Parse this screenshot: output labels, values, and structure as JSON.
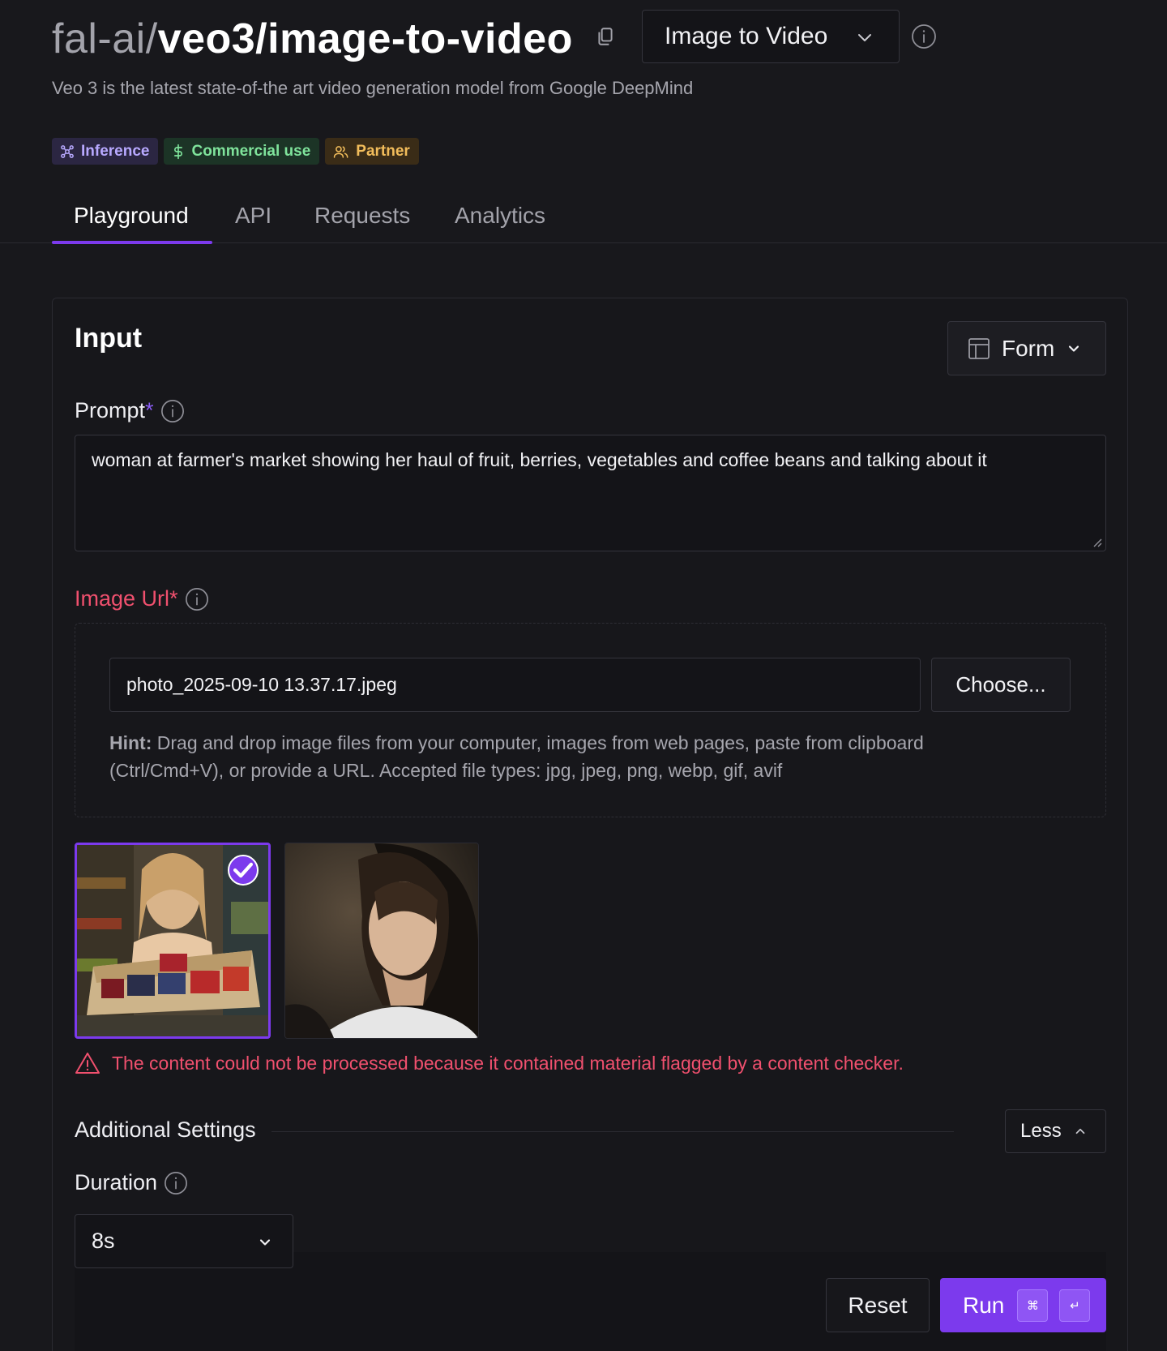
{
  "header": {
    "namespace": "fal-ai/",
    "model_slug": "veo3/image-to-video",
    "mode_select": "Image to Video",
    "subtitle": "Veo 3 is the latest state-of-the art video generation model from Google DeepMind"
  },
  "badges": [
    {
      "label": "Inference",
      "icon": "network-icon"
    },
    {
      "label": "Commercial use",
      "icon": "dollar-icon"
    },
    {
      "label": "Partner",
      "icon": "users-icon"
    }
  ],
  "tabs": [
    {
      "label": "Playground",
      "active": true
    },
    {
      "label": "API",
      "active": false
    },
    {
      "label": "Requests",
      "active": false
    },
    {
      "label": "Analytics",
      "active": false
    }
  ],
  "input": {
    "title": "Input",
    "view_mode": "Form",
    "prompt": {
      "label": "Prompt",
      "required_mark": "*",
      "value": "woman at farmer's market showing her haul of fruit, berries, vegetables and coffee beans and talking about it"
    },
    "image_url": {
      "label": "Image Url",
      "required_mark": "*",
      "value": "photo_2025-09-10 13.37.17.jpeg",
      "choose_label": "Choose...",
      "hint_bold": "Hint:",
      "hint_text": " Drag and drop image files from your computer, images from web pages, paste from clipboard (Ctrl/Cmd+V), or provide a URL. Accepted file types: jpg, jpeg, png, webp, gif, avif"
    },
    "error_message": "The content could not be processed because it contained material flagged by a content checker.",
    "additional_settings": {
      "label": "Additional Settings",
      "toggle_label": "Less"
    },
    "duration": {
      "label": "Duration",
      "value": "8s"
    },
    "actions": {
      "reset": "Reset",
      "run": "Run",
      "shortcut_mod": "⌘",
      "shortcut_key": "↵"
    }
  },
  "colors": {
    "accent": "#7c3aed",
    "error": "#f0506e",
    "background": "#18181c"
  }
}
